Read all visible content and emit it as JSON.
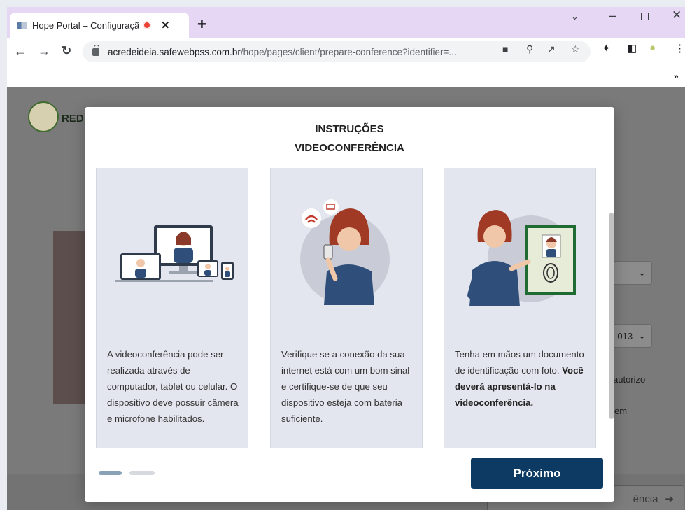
{
  "browser": {
    "tab_title": "Hope Portal – Configuração",
    "tab_close": "✕",
    "new_tab": "+",
    "url_domain": "acredeideia.safewebpss.com.br",
    "url_path": "/hope/pages/client/prepare-conference?identifier=...",
    "bookmarks_more": "»"
  },
  "background_page": {
    "logo_text": "RED",
    "select_value": "013",
    "text_autorizo": "autorizo",
    "text_em": "em",
    "footer_button": "ência"
  },
  "modal": {
    "title_line1": "INSTRUÇÕES",
    "title_line2": "VIDEOCONFERÊNCIA",
    "cards": [
      {
        "illustration": "devices-illustration",
        "text": "A videoconferência pode ser realizada através de computador, tablet ou celular. O dispositivo deve possuir câmera e microfone habilitados."
      },
      {
        "illustration": "internet-connection-illustration",
        "text": "Verifique se a conexão da sua internet está com um bom sinal e certifique-se de que seu dispositivo esteja com bateria suficiente."
      },
      {
        "illustration": "id-document-illustration",
        "text": "Tenha em mãos um documento de identificação com foto.",
        "text_bold": "Você deverá apresentá-lo na videoconferência."
      }
    ],
    "pagination": {
      "current": 1,
      "total": 2
    },
    "next_button": "Próximo"
  },
  "colors": {
    "tab_strip": "#e6d7f5",
    "primary_button": "#0c3a63",
    "card_bg": "#e3e6ee",
    "overlay_bg": "#7a7a7a"
  }
}
